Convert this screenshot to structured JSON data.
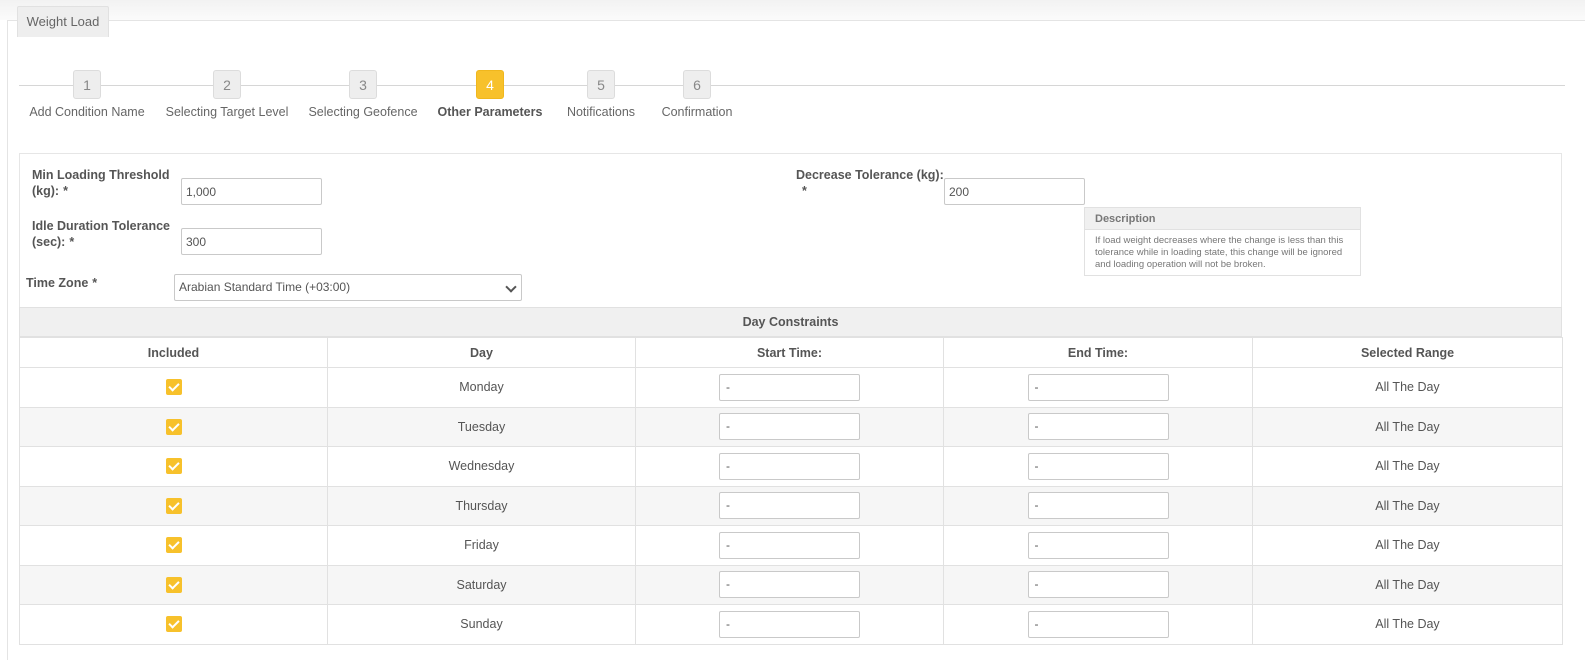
{
  "page_tab": "Weight Load",
  "wizard": {
    "steps": [
      {
        "num": "1",
        "label": "Add Condition Name"
      },
      {
        "num": "2",
        "label": "Selecting Target Level"
      },
      {
        "num": "3",
        "label": "Selecting Geofence"
      },
      {
        "num": "4",
        "label": "Other Parameters"
      },
      {
        "num": "5",
        "label": "Notifications"
      },
      {
        "num": "6",
        "label": "Confirmation"
      }
    ],
    "active_step": "4"
  },
  "form": {
    "min_loading": {
      "label_line1": "Min Loading Threshold",
      "label_line2": "(kg):",
      "required": "*",
      "value": "1,000"
    },
    "idle_duration": {
      "label_line1": "Idle Duration Tolerance",
      "label_line2": "(sec):",
      "required": "*",
      "value": "300"
    },
    "decrease_tolerance": {
      "label": "Decrease Tolerance (kg):",
      "required": "*",
      "value": "200"
    },
    "time_zone": {
      "label": "Time Zone",
      "required": "*",
      "value": "Arabian Standard Time (+03:00)"
    }
  },
  "description": {
    "title": "Description",
    "text": "If load weight decreases where the change is less than this tolerance while in loading state, this change will be ignored and loading operation will not be broken."
  },
  "day_constraints": {
    "title": "Day Constraints",
    "columns": [
      "Included",
      "Day",
      "Start Time:",
      "End Time:",
      "Selected Range"
    ],
    "rows": [
      {
        "day": "Monday",
        "start": "-",
        "end": "-",
        "range": "All The Day"
      },
      {
        "day": "Tuesday",
        "start": "-",
        "end": "-",
        "range": "All The Day"
      },
      {
        "day": "Wednesday",
        "start": "-",
        "end": "-",
        "range": "All The Day"
      },
      {
        "day": "Thursday",
        "start": "-",
        "end": "-",
        "range": "All The Day"
      },
      {
        "day": "Friday",
        "start": "-",
        "end": "-",
        "range": "All The Day"
      },
      {
        "day": "Saturday",
        "start": "-",
        "end": "-",
        "range": "All The Day"
      },
      {
        "day": "Sunday",
        "start": "-",
        "end": "-",
        "range": "All The Day"
      }
    ]
  },
  "colors": {
    "accent": "#f7c12b"
  }
}
